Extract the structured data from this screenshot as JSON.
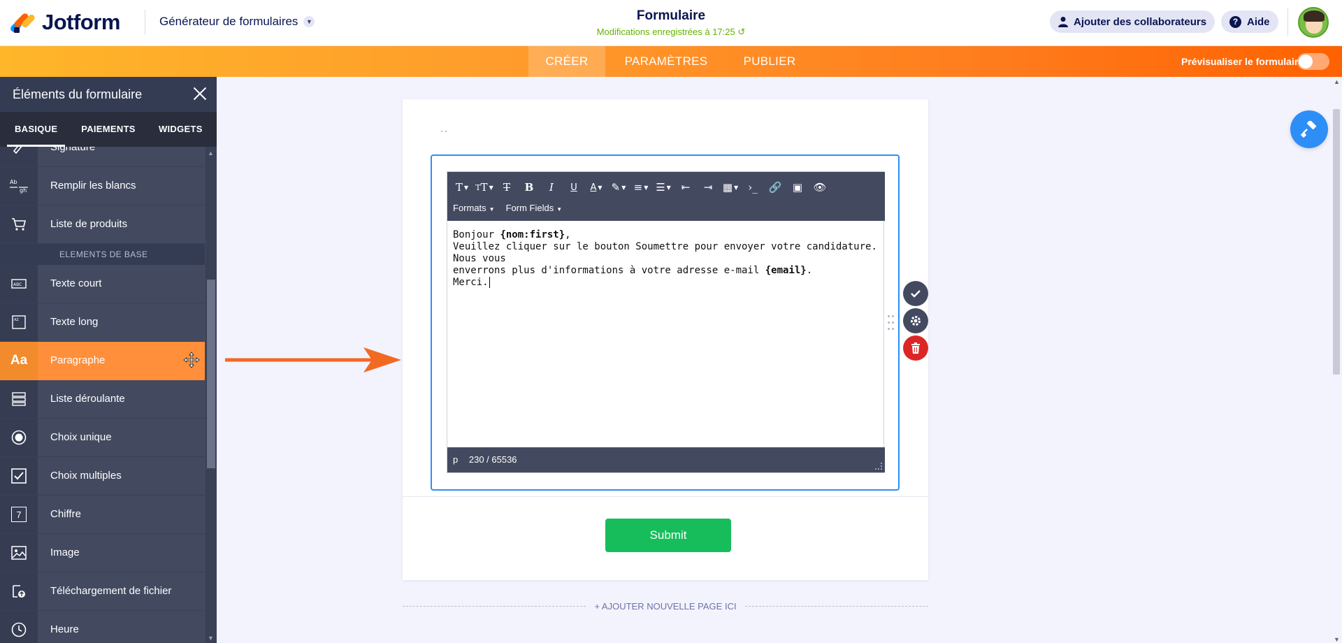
{
  "header": {
    "brand": "Jotform",
    "builder_menu": "Générateur de formulaires",
    "form_title": "Formulaire",
    "save_status": "Modifications enregistrées à 17:25",
    "collab_label": "Ajouter des collaborateurs",
    "help_label": "Aide"
  },
  "nav": {
    "tabs": [
      {
        "label": "CRÉER"
      },
      {
        "label": "PARAMÈTRES"
      },
      {
        "label": "PUBLIER"
      }
    ],
    "preview_label": "Prévisualiser le formulaire"
  },
  "sidebar": {
    "title": "Éléments du formulaire",
    "tabs": [
      {
        "label": "BASIQUE"
      },
      {
        "label": "PAIEMENTS"
      },
      {
        "label": "WIDGETS"
      }
    ],
    "items_top": [
      {
        "label": "Signature",
        "icon": "signature-icon"
      },
      {
        "label": "Remplir les blancs",
        "icon": "fill-blank-icon"
      },
      {
        "label": "Liste de produits",
        "icon": "cart-icon"
      }
    ],
    "section": "ELEMENTS DE BASE",
    "items": [
      {
        "label": "Texte court",
        "icon": "short-text-icon"
      },
      {
        "label": "Texte long",
        "icon": "long-text-icon"
      },
      {
        "label": "Paragraphe",
        "icon": "paragraph-icon"
      },
      {
        "label": "Liste déroulante",
        "icon": "dropdown-icon"
      },
      {
        "label": "Choix unique",
        "icon": "radio-icon"
      },
      {
        "label": "Choix multiples",
        "icon": "checkbox-icon"
      },
      {
        "label": "Chiffre",
        "icon": "number-icon"
      },
      {
        "label": "Image",
        "icon": "image-icon"
      },
      {
        "label": "Téléchargement de fichier",
        "icon": "upload-icon"
      },
      {
        "label": "Heure",
        "icon": "clock-icon"
      }
    ],
    "paragraph_icon_text": "Aa",
    "number_icon_text": "7"
  },
  "editor": {
    "menu_formats": "Formats",
    "menu_fields": "Form Fields",
    "line1_prefix": "Bonjour ",
    "line1_tag": "{nom:first}",
    "line1_suffix": ",",
    "line2": "Veuillez cliquer sur le bouton Soumettre pour envoyer votre candidature. Nous vous",
    "line3_prefix": "enverrons plus d'informations à votre adresse e-mail ",
    "line3_tag": "{email}",
    "line3_suffix": ".",
    "line4": "Merci.",
    "status_tag": "p",
    "char_count": "230 / 65536"
  },
  "form": {
    "submit_label": "Submit",
    "add_page_label": "+ AJOUTER NOUVELLE PAGE ICI"
  },
  "colors": {
    "accent_orange": "#ff8f3a",
    "accent_blue": "#2e8ef7",
    "submit_green": "#18bd5b",
    "delete_red": "#dc2626"
  }
}
